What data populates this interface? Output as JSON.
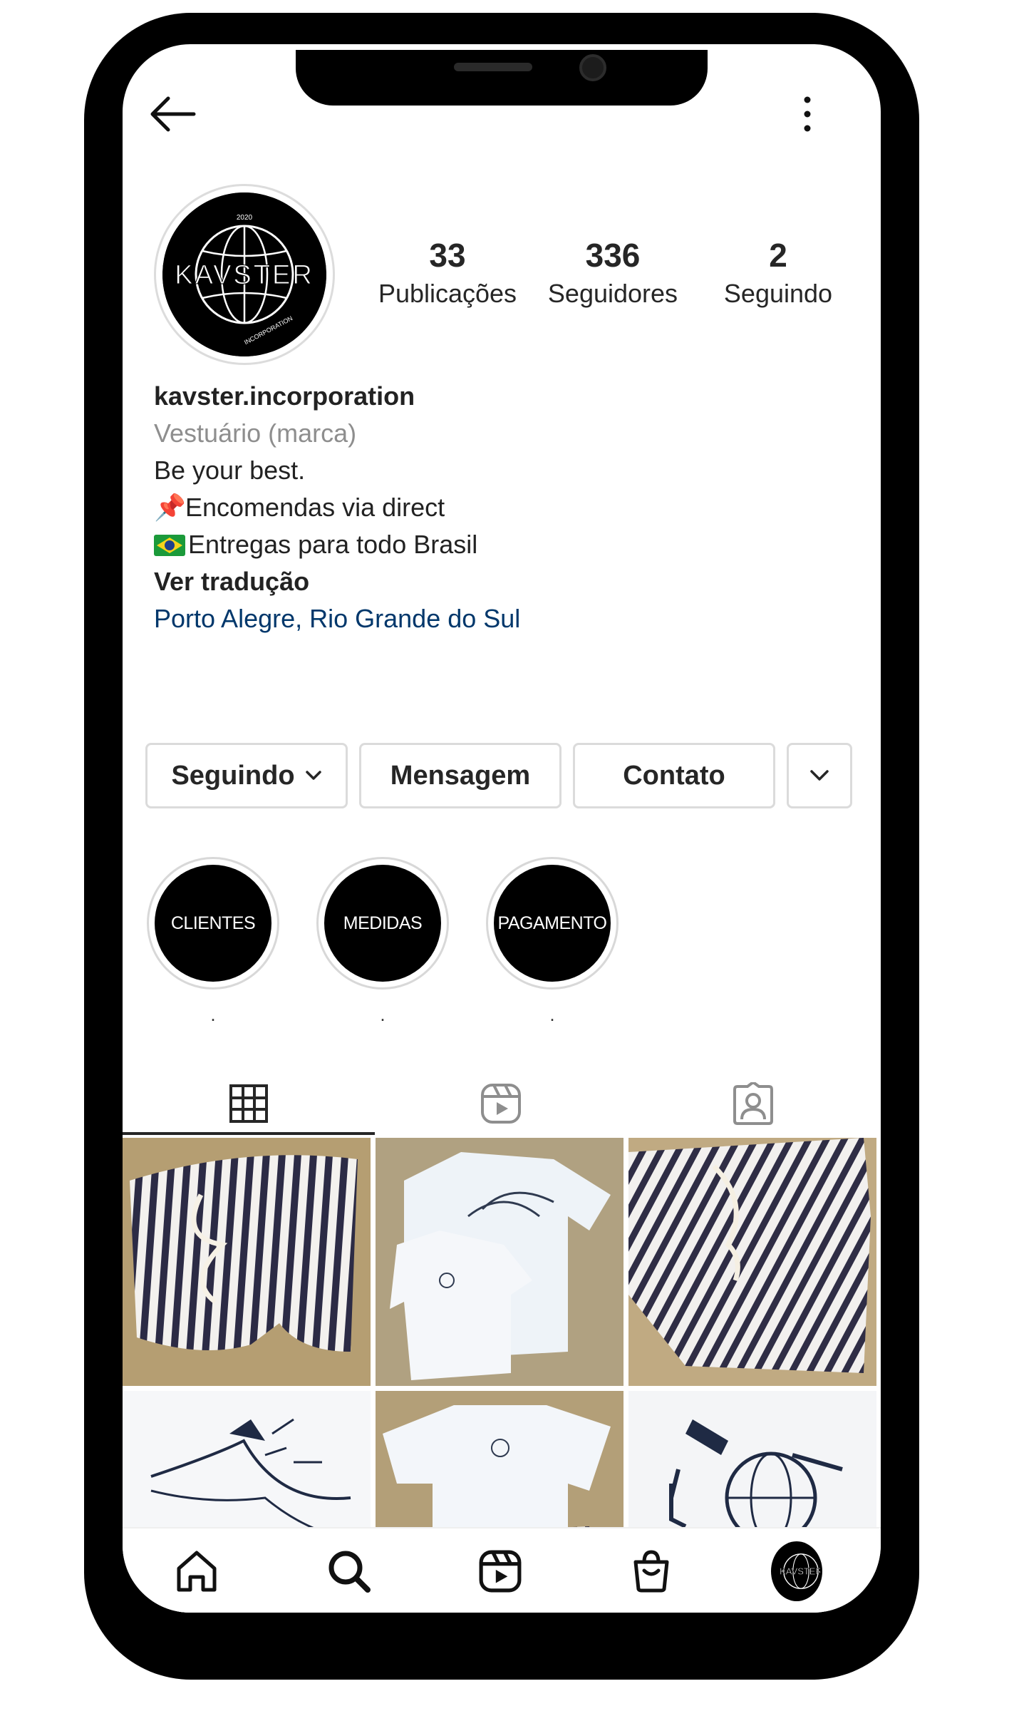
{
  "profile": {
    "username": "kavster.incorporation",
    "category": "Vestuário (marca)",
    "bio_line1": "Be your best.",
    "bio_line2": "Encomendas via direct",
    "bio_line3": "Entregas para todo Brasil",
    "translate": "Ver tradução",
    "location": "Porto Alegre, Rio Grande do Sul",
    "logo_text": "KAVSTER",
    "logo_year": "2020",
    "logo_sub": "INCORPORATION"
  },
  "stats": [
    {
      "value": "33",
      "label": "Publicações"
    },
    {
      "value": "336",
      "label": "Seguidores"
    },
    {
      "value": "2",
      "label": "Seguindo"
    }
  ],
  "actions": {
    "following": "Seguindo",
    "message": "Mensagem",
    "contact": "Contato"
  },
  "highlights": [
    {
      "title": "CLIENTES",
      "caption": "."
    },
    {
      "title": "MEDIDAS",
      "caption": "."
    },
    {
      "title": "PAGAMENTO",
      "caption": "."
    }
  ],
  "icons": {
    "back": "arrow-left-icon",
    "more": "more-vertical-icon",
    "grid": "grid-icon",
    "reels": "reels-icon",
    "tagged": "tagged-icon",
    "home": "home-icon",
    "search": "search-icon",
    "shop": "shop-bag-icon"
  },
  "colors": {
    "link": "#00376b",
    "secondary_text": "#8e8e8e",
    "border": "#dbdbdb"
  }
}
